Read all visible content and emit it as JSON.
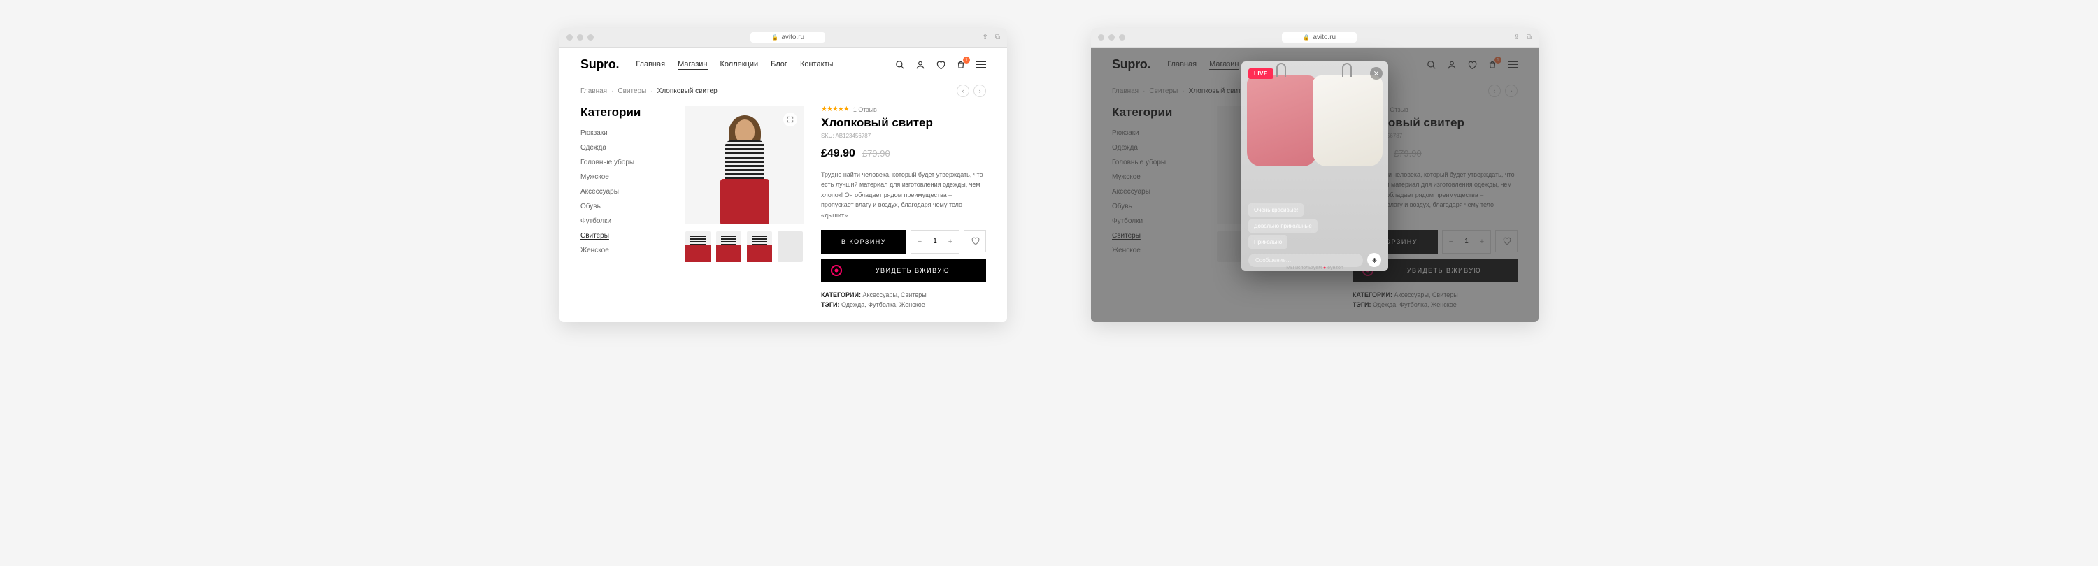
{
  "browser": {
    "url": "avito.ru"
  },
  "header": {
    "logo": "Supro.",
    "nav": [
      "Главная",
      "Магазин",
      "Коллекции",
      "Блог",
      "Контакты"
    ],
    "active_nav_index": 1,
    "cart_count": "1"
  },
  "breadcrumb": {
    "items": [
      "Главная",
      "Свитеры",
      "Хлопковый свитер"
    ]
  },
  "sidebar": {
    "title": "Категории",
    "items": [
      "Рюкзаки",
      "Одежда",
      "Головные уборы",
      "Мужское",
      "Аксессуары",
      "Обувь",
      "Футболки",
      "Свитеры",
      "Женское"
    ],
    "active_index": 7
  },
  "product": {
    "rating_text": "1 Отзыв",
    "title": "Хлопковый свитер",
    "sku_label": "SKU:",
    "sku_value": "AB123456787",
    "price": "£49.90",
    "old_price": "£79.90",
    "description": "Трудно найти человека, который будет утверждать, что есть лучший материал для изготовления одежды, чем хлопок! Он обладает рядом преимущества – пропускает влагу и воздух, благодаря чему тело «дышит»",
    "add_to_cart": "В КОРЗИНУ",
    "quantity": "1",
    "see_live": "УВИДЕТЬ ВЖИВУЮ",
    "categories_label": "КАТЕГОРИИ:",
    "categories_value": "Аксессуары, Свитеры",
    "tags_label": "ТЭГИ:",
    "tags_value": "Одежда, Футболка, Женское"
  },
  "modal": {
    "live_badge": "LIVE",
    "chat_messages": [
      "Очень красивые!",
      "Довольно прикольные",
      "Прикольно"
    ],
    "input_placeholder": "Сообщение…",
    "powered_by": "Мы используем",
    "powered_brand": "eyezon"
  }
}
